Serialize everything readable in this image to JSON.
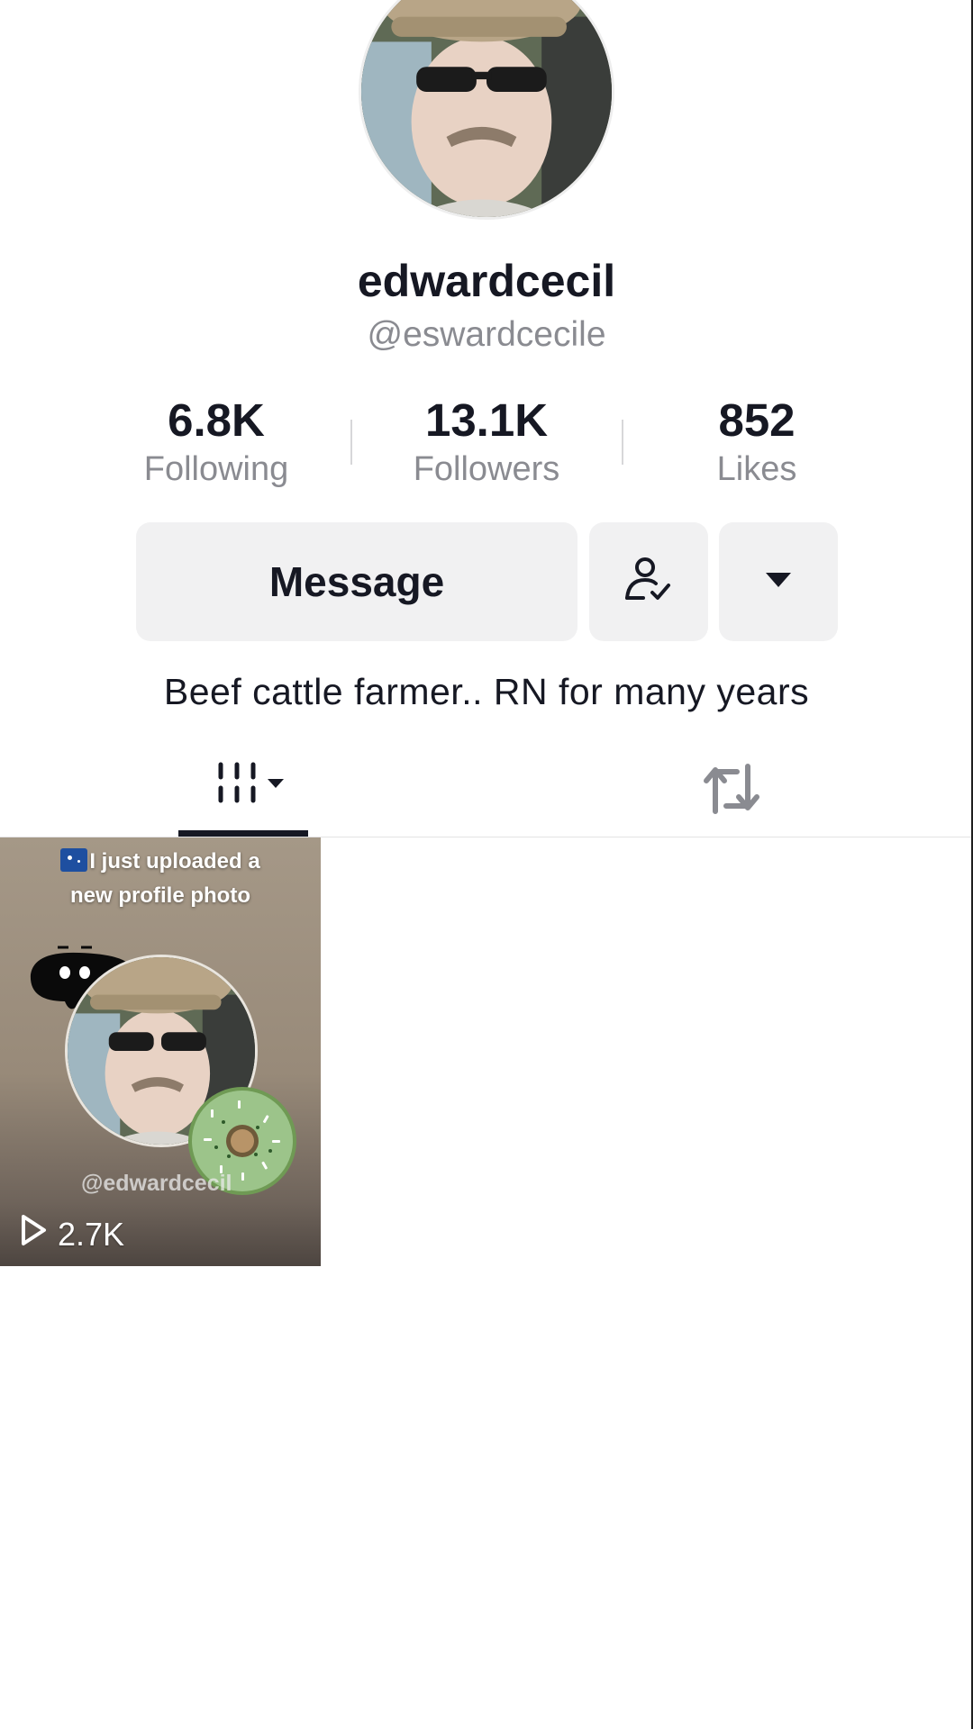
{
  "profile": {
    "display_name": "edwardcecil",
    "handle": "@eswardcecile",
    "bio": "Beef cattle farmer.. RN for many years"
  },
  "stats": {
    "following": {
      "value": "6.8K",
      "label": "Following"
    },
    "followers": {
      "value": "13.1K",
      "label": "Followers"
    },
    "likes": {
      "value": "852",
      "label": "Likes"
    }
  },
  "actions": {
    "message_label": "Message",
    "friend_icon": "person-check-icon",
    "more_icon": "caret-down-icon"
  },
  "tabs": [
    {
      "name": "videos",
      "icon": "grid-lines-icon",
      "active": true
    },
    {
      "name": "reposts",
      "icon": "repost-icon",
      "active": false
    }
  ],
  "videos": [
    {
      "caption_line1": "I just uploaded a",
      "caption_line2": "new profile photo",
      "watermark": "@edwardcecil",
      "views": "2.7K"
    }
  ],
  "colors": {
    "text_primary": "#161823",
    "text_secondary": "#8a8b91",
    "button_bg": "#f1f1f2",
    "divider": "#e3e3e4"
  }
}
